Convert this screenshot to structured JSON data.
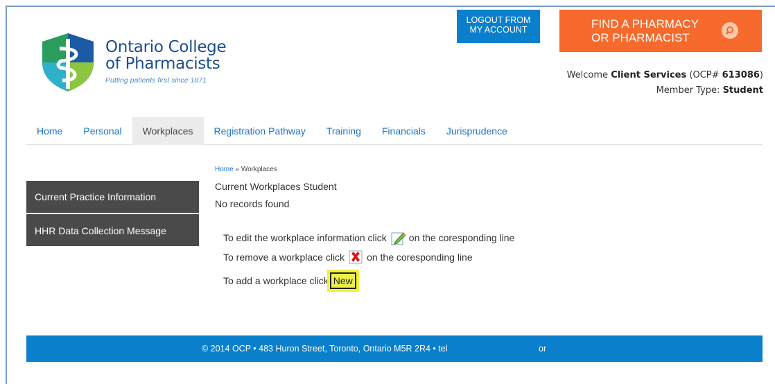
{
  "brand": {
    "name_line1": "Ontario College",
    "name_line2": "of Pharmacists",
    "tagline": "Putting patients first since 1871"
  },
  "header": {
    "logout_label_line1": "LOGOUT FROM",
    "logout_label_line2": "MY ACCOUNT",
    "find_label_line1": "FIND A PHARMACY",
    "find_label_line2": "OR PHARMACIST",
    "welcome_prefix": "Welcome",
    "user_name": "Client Services",
    "ocp_prefix": "(OCP#",
    "ocp_number": "613086",
    "ocp_suffix": ")",
    "member_type_label": "Member Type:",
    "member_type": "Student"
  },
  "nav": {
    "tabs": [
      "Home",
      "Personal",
      "Workplaces",
      "Registration Pathway",
      "Training",
      "Financials",
      "Jurisprudence"
    ],
    "active": "Workplaces"
  },
  "sidebar": {
    "items": [
      "Current Practice Information",
      "HHR Data Collection Message"
    ]
  },
  "main": {
    "breadcrumb_home": "Home",
    "breadcrumb_sep": "»",
    "breadcrumb_current": "Workplaces",
    "title": "Current Workplaces Student",
    "empty_message": "No records found",
    "edit_prefix": "To edit the workplace information click",
    "edit_suffix": "on the coresponding line",
    "remove_prefix": "To remove a workplace click",
    "remove_suffix": "on the coresponding line",
    "add_prefix": "To add a workplace click",
    "new_label": "New"
  },
  "footer": {
    "text": "© 2014 OCP • 483 Huron Street, Toronto, Ontario M5R 2R4 • tel",
    "or": "or"
  },
  "colors": {
    "brand_blue": "#0a7fcb",
    "find_orange": "#f66a2d",
    "sidebar_dark": "#4a4a4a",
    "link_blue": "#1a73c9",
    "highlight_yellow": "#eef04a"
  }
}
